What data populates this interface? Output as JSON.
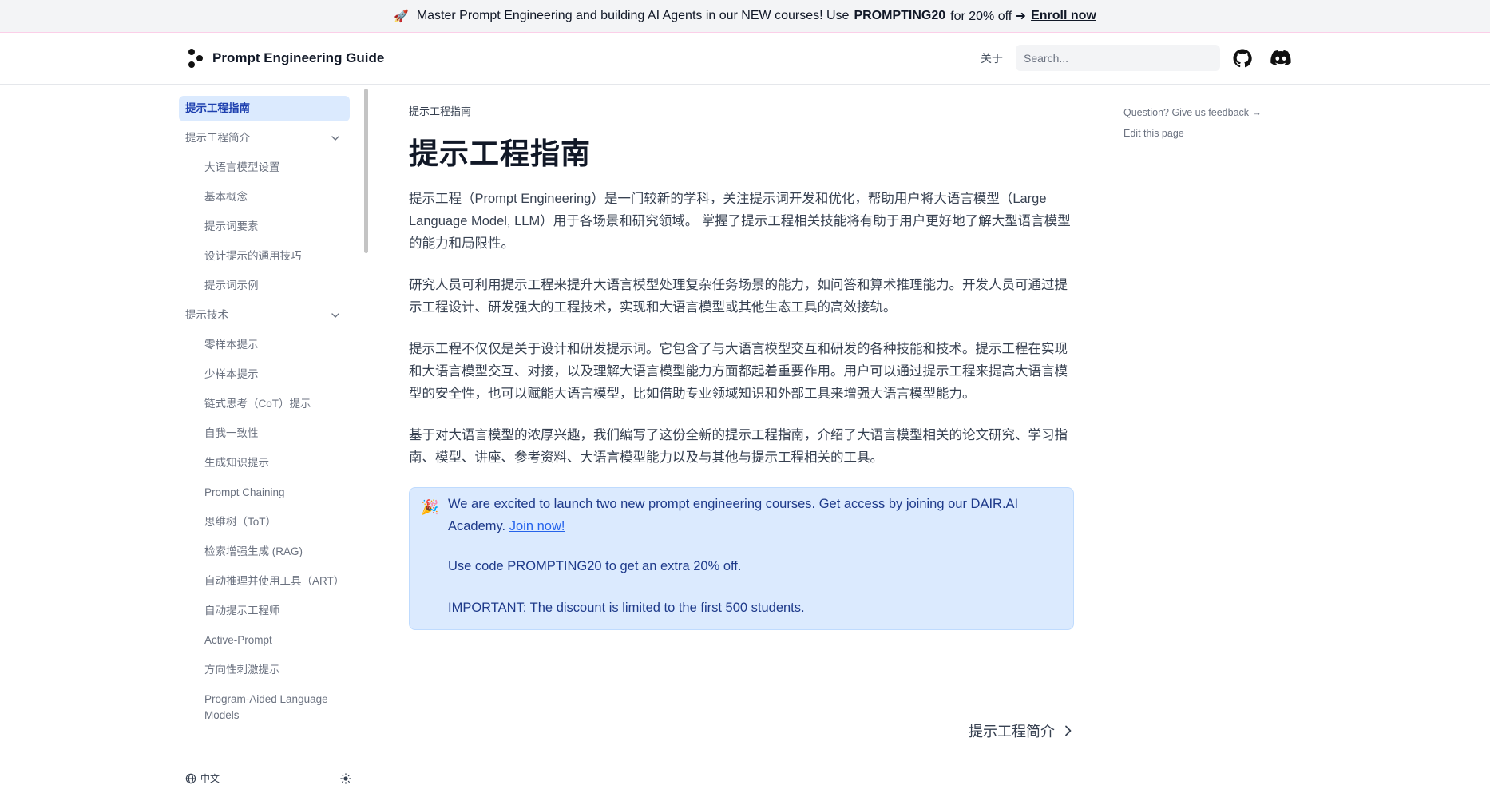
{
  "banner": {
    "text_before": "Master Prompt Engineering and building AI Agents in our NEW courses! Use",
    "code": "PROMPTING20",
    "text_after": "for 20% off ➜",
    "link": "Enroll now"
  },
  "navbar": {
    "title": "Prompt Engineering Guide",
    "about": "关于",
    "search_placeholder": "Search..."
  },
  "sidebar": {
    "items": [
      {
        "label": "提示工程指南",
        "level": 0,
        "active": true
      },
      {
        "label": "提示工程简介",
        "level": 0,
        "expanded": true
      },
      {
        "label": "大语言模型设置",
        "level": 1
      },
      {
        "label": "基本概念",
        "level": 1
      },
      {
        "label": "提示词要素",
        "level": 1
      },
      {
        "label": "设计提示的通用技巧",
        "level": 1
      },
      {
        "label": "提示词示例",
        "level": 1
      },
      {
        "label": "提示技术",
        "level": 0,
        "expanded": true
      },
      {
        "label": "零样本提示",
        "level": 1
      },
      {
        "label": "少样本提示",
        "level": 1
      },
      {
        "label": "链式思考（CoT）提示",
        "level": 1
      },
      {
        "label": "自我一致性",
        "level": 1
      },
      {
        "label": "生成知识提示",
        "level": 1
      },
      {
        "label": "Prompt Chaining",
        "level": 1
      },
      {
        "label": "思维树（ToT）",
        "level": 1
      },
      {
        "label": "检索增强生成 (RAG)",
        "level": 1
      },
      {
        "label": "自动推理并使用工具（ART）",
        "level": 1
      },
      {
        "label": "自动提示工程师",
        "level": 1
      },
      {
        "label": "Active-Prompt",
        "level": 1
      },
      {
        "label": "方向性刺激提示",
        "level": 1
      },
      {
        "label": "Program-Aided Language Models",
        "level": 1
      }
    ],
    "language": "中文"
  },
  "main": {
    "breadcrumb": "提示工程指南",
    "title": "提示工程指南",
    "paragraphs": [
      "提示工程（Prompt Engineering）是一门较新的学科，关注提示词开发和优化，帮助用户将大语言模型（Large Language Model, LLM）用于各场景和研究领域。 掌握了提示工程相关技能将有助于用户更好地了解大型语言模型的能力和局限性。",
      "研究人员可利用提示工程来提升大语言模型处理复杂任务场景的能力，如问答和算术推理能力。开发人员可通过提示工程设计、研发强大的工程技术，实现和大语言模型或其他生态工具的高效接轨。",
      "提示工程不仅仅是关于设计和研发提示词。它包含了与大语言模型交互和研发的各种技能和技术。提示工程在实现和大语言模型交互、对接，以及理解大语言模型能力方面都起着重要作用。用户可以通过提示工程来提高大语言模型的安全性，也可以赋能大语言模型，比如借助专业领域知识和外部工具来增强大语言模型能力。",
      "基于对大语言模型的浓厚兴趣，我们编写了这份全新的提示工程指南，介绍了大语言模型相关的论文研究、学习指南、模型、讲座、参考资料、大语言模型能力以及与其他与提示工程相关的工具。"
    ],
    "callout": {
      "line1": "We are excited to launch two new prompt engineering courses. Get access by joining our DAIR.AI Academy.",
      "link": "Join now!",
      "line2": "Use code PROMPTING20 to get an extra 20% off.",
      "line3": "IMPORTANT: The discount is limited to the first 500 students."
    },
    "next": "提示工程简介"
  },
  "toc": {
    "feedback": "Question? Give us feedback →",
    "edit": "Edit this page"
  },
  "colors": {
    "accent": "#2563eb",
    "active_bg": "#dbeafe",
    "callout_bg": "#dbeafe"
  }
}
